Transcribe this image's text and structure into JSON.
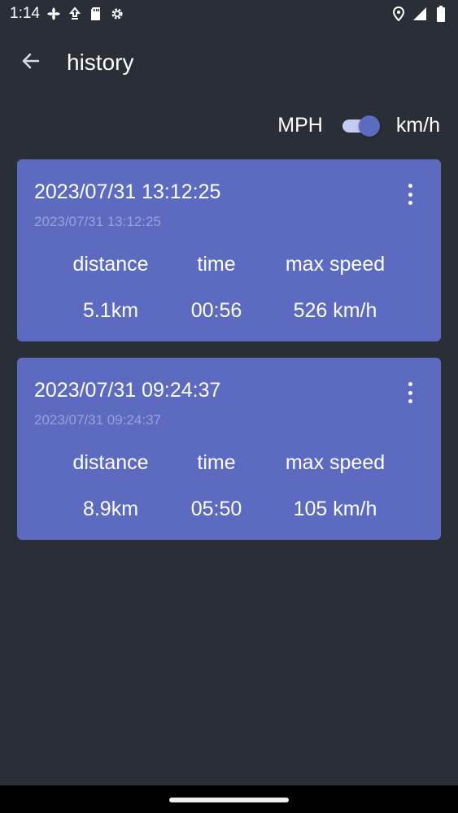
{
  "status_bar": {
    "time": "1:14",
    "left_icons": [
      "fan-icon",
      "download-icon",
      "sd-card-icon",
      "settings-gear-icon"
    ],
    "right_icons": [
      "location-icon",
      "signal-icon",
      "battery-icon"
    ]
  },
  "app_bar": {
    "title": "history",
    "back_icon": "arrow-left-icon"
  },
  "units": {
    "left_label": "MPH",
    "right_label": "km/h",
    "toggle_on": true
  },
  "labels": {
    "distance": "distance",
    "time": "time",
    "max_speed": "max speed"
  },
  "records": [
    {
      "title": "2023/07/31 13:12:25",
      "subtitle": "2023/07/31 13:12:25",
      "distance": "5.1km",
      "time": "00:56",
      "max_speed": "526 km/h"
    },
    {
      "title": "2023/07/31 09:24:37",
      "subtitle": "2023/07/31 09:24:37",
      "distance": "8.9km",
      "time": "05:50",
      "max_speed": "105 km/h"
    }
  ],
  "colors": {
    "background": "#2a2f37",
    "card": "#5c6bc0",
    "subtitle": "#9aa2d6",
    "nav_bar": "#000000"
  }
}
